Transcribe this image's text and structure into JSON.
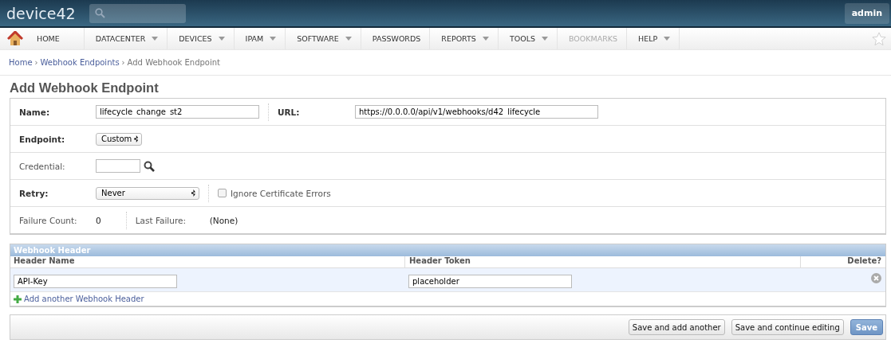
{
  "topbar": {
    "logo": "device42",
    "user": "admin"
  },
  "nav": [
    {
      "label": "HOME",
      "dropdown": false,
      "disabled": false
    },
    {
      "label": "DATACENTER",
      "dropdown": true,
      "disabled": false
    },
    {
      "label": "DEVICES",
      "dropdown": true,
      "disabled": false
    },
    {
      "label": "IPAM",
      "dropdown": true,
      "disabled": false
    },
    {
      "label": "SOFTWARE",
      "dropdown": true,
      "disabled": false
    },
    {
      "label": "PASSWORDS",
      "dropdown": false,
      "disabled": false
    },
    {
      "label": "REPORTS",
      "dropdown": true,
      "disabled": false
    },
    {
      "label": "TOOLS",
      "dropdown": true,
      "disabled": false
    },
    {
      "label": "BOOKMARKS",
      "dropdown": false,
      "disabled": true
    },
    {
      "label": "HELP",
      "dropdown": true,
      "disabled": false
    }
  ],
  "breadcrumb": [
    {
      "label": "Home",
      "link": true
    },
    {
      "separator": "›",
      "label": "Webhook Endpoints",
      "link": true
    },
    {
      "separator": "›",
      "label": "Add Webhook Endpoint",
      "link": false
    }
  ],
  "title": "Add Webhook Endpoint",
  "form": {
    "name": {
      "label": "Name:",
      "value": "lifecycle_change_st2",
      "required": true
    },
    "url": {
      "label": "URL:",
      "value": "https://0.0.0.0/api/v1/webhooks/d42_lifecycle",
      "required": true
    },
    "endpoint": {
      "label": "Endpoint:",
      "value": "Custom",
      "required": true
    },
    "credential": {
      "label": "Credential:",
      "required": false
    },
    "retry": {
      "label": "Retry:",
      "value": "Never",
      "required": true
    },
    "ignore_cert": {
      "label": "Ignore Certificate Errors",
      "checked": false
    },
    "failure_count": {
      "label": "Failure Count:",
      "value": "0",
      "required": false
    },
    "last_failure": {
      "label": "Last Failure:",
      "value": "(None)",
      "required": false
    }
  },
  "webhook_header": {
    "title": "Webhook Header",
    "columns": [
      "Header Name",
      "Header Token",
      "Delete?"
    ],
    "rows": [
      {
        "name": "API-Key",
        "token": "placeholder"
      }
    ],
    "add_link": "Add another Webhook Header"
  },
  "buttons": [
    {
      "label": "Save and add another",
      "kind": "default"
    },
    {
      "label": "Save and continue editing",
      "kind": "default"
    },
    {
      "label": "Save",
      "kind": "primary"
    }
  ]
}
